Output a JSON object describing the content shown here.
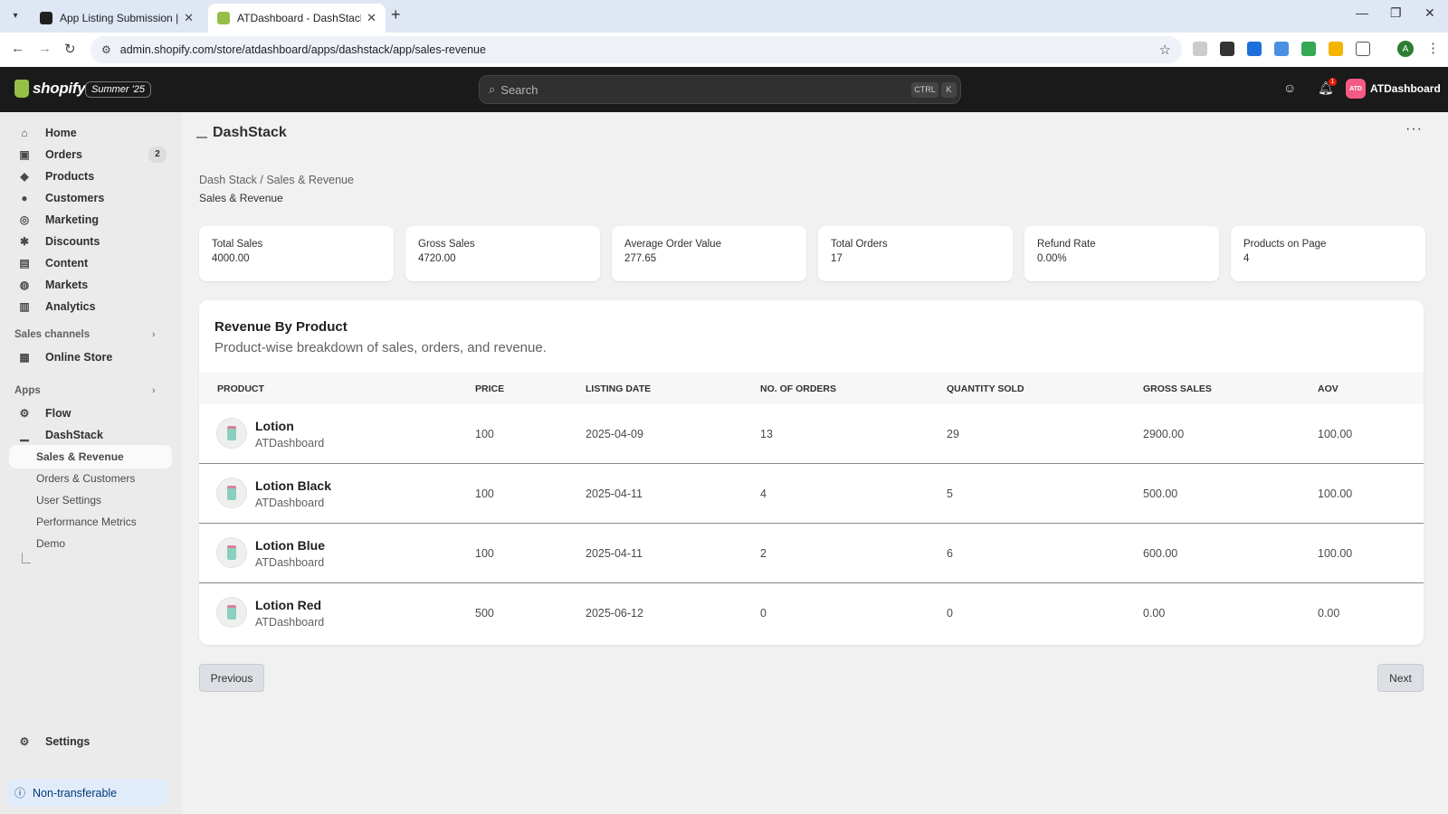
{
  "browser": {
    "tabs": [
      {
        "title": "App Listing Submission | Shopify",
        "active": false
      },
      {
        "title": "ATDashboard - DashStack - Shopify",
        "active": true
      }
    ],
    "url": "admin.shopify.com/store/atdashboard/apps/dashstack/app/sales-revenue",
    "profile_initial": "A"
  },
  "topbar": {
    "logo_text": "shopify",
    "edition": "Summer '25",
    "search_placeholder": "Search",
    "shortcut_key1": "CTRL",
    "shortcut_key2": "K",
    "notification_count": "1",
    "store_initials": "ATD",
    "store_name": "ATDashboard"
  },
  "sidebar": {
    "items": [
      {
        "label": "Home",
        "icon": "home-icon"
      },
      {
        "label": "Orders",
        "icon": "inbox-icon",
        "badge": "2"
      },
      {
        "label": "Products",
        "icon": "tag-icon"
      },
      {
        "label": "Customers",
        "icon": "person-icon"
      },
      {
        "label": "Marketing",
        "icon": "target-icon"
      },
      {
        "label": "Discounts",
        "icon": "discount-icon"
      },
      {
        "label": "Content",
        "icon": "content-icon"
      },
      {
        "label": "Markets",
        "icon": "globe-icon"
      },
      {
        "label": "Analytics",
        "icon": "bar-chart-icon"
      }
    ],
    "sales_channels_heading": "Sales channels",
    "online_store": "Online Store",
    "apps_heading": "Apps",
    "flow": "Flow",
    "dashstack": "DashStack",
    "app_pages": [
      "Sales & Revenue",
      "Orders & Customers",
      "User Settings",
      "Performance Metrics",
      "Demo"
    ],
    "settings": "Settings",
    "non_transferable": "Non-transferable"
  },
  "page": {
    "app_title": "DashStack",
    "breadcrumb": "Dash Stack / Sales & Revenue",
    "subtitle": "Sales & Revenue"
  },
  "stats": [
    {
      "label": "Total Sales",
      "value": "4000.00"
    },
    {
      "label": "Gross Sales",
      "value": "4720.00"
    },
    {
      "label": "Average Order Value",
      "value": "277.65"
    },
    {
      "label": "Total Orders",
      "value": "17"
    },
    {
      "label": "Refund Rate",
      "value": "0.00%"
    },
    {
      "label": "Products on Page",
      "value": "4"
    }
  ],
  "revenue": {
    "title": "Revenue By Product",
    "description": "Product-wise breakdown of sales, orders, and revenue.",
    "columns": [
      "PRODUCT",
      "PRICE",
      "LISTING DATE",
      "NO. OF ORDERS",
      "QUANTITY SOLD",
      "GROSS SALES",
      "AOV"
    ],
    "rows": [
      {
        "name": "Lotion",
        "vendor": "ATDashboard",
        "price": "100",
        "date": "2025-04-09",
        "orders": "13",
        "qty": "29",
        "gross": "2900.00",
        "aov": "100.00"
      },
      {
        "name": "Lotion Black",
        "vendor": "ATDashboard",
        "price": "100",
        "date": "2025-04-11",
        "orders": "4",
        "qty": "5",
        "gross": "500.00",
        "aov": "100.00"
      },
      {
        "name": "Lotion Blue",
        "vendor": "ATDashboard",
        "price": "100",
        "date": "2025-04-11",
        "orders": "2",
        "qty": "6",
        "gross": "600.00",
        "aov": "100.00"
      },
      {
        "name": "Lotion Red",
        "vendor": "ATDashboard",
        "price": "500",
        "date": "2025-06-12",
        "orders": "0",
        "qty": "0",
        "gross": "0.00",
        "aov": "0.00"
      }
    ]
  },
  "pagination": {
    "previous": "Previous",
    "next": "Next"
  },
  "colors": {
    "topbar": "#1a1a1a",
    "sidebar": "#ebebeb",
    "accent_avatar": "#f55a86",
    "shopify_green": "#95bf47"
  }
}
